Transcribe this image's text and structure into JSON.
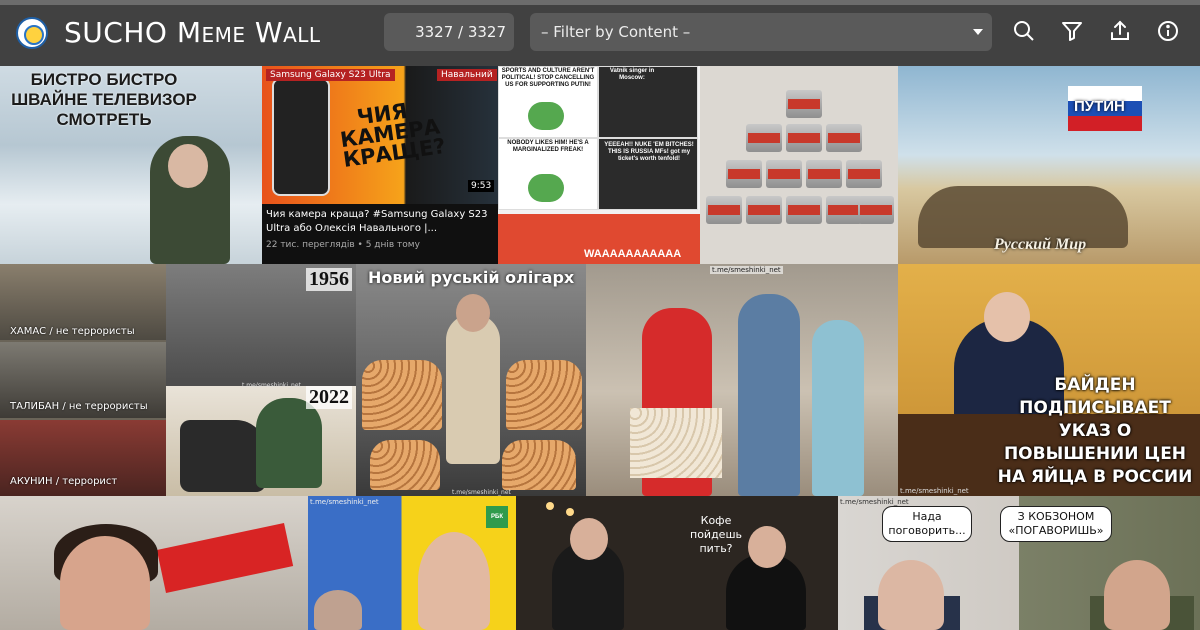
{
  "app": {
    "title_first": "SUCHO ",
    "title_rest": "Meme Wall",
    "counter": "3327 / 3327",
    "filter_placeholder": "– Filter by Content –"
  },
  "toolbar": {
    "icons": [
      "search-icon",
      "filter-icon",
      "share-icon",
      "info-icon"
    ]
  },
  "memes": {
    "m1": {
      "caption": "БИСТРО БИСТРО ШВАЙНЕ ТЕЛЕВИЗОР СМОТРЕТЬ"
    },
    "m2": {
      "badge_left": "Samsung Galaxy S23 Ultra",
      "badge_right": "Навальний",
      "headline": "ЧИЯ КАМЕРА КРАЩЕ?",
      "duration": "9:53",
      "video_title": "Чия камера краща? #Samsung Galaxy S23 Ultra або Олексія Навального |...",
      "video_meta": "22 тис. переглядів • 5 днів тому"
    },
    "m3": {
      "q1": "SPORTS AND CULTURE AREN'T POLITICAL! STOP CANCELLING US FOR SUPPORTING PUTIN!",
      "q2": "Vatnik singer in Moscow:",
      "q3": "NOBODY LIKES HIM! HE'S A MARGINALIZED FREAK!",
      "q4": "YEEEAH!! NUKE 'EM BITCHES! THIS IS RUSSIA MFs! got my ticket's worth tenfold!",
      "bottom": "WAAAAAAAAAAA"
    },
    "m4": {},
    "m5": {
      "flag_text": "ПУТИН",
      "caption": "Русский Мир"
    },
    "m6": {
      "cap1": "ХАМАС / не террористы",
      "cap2": "ТАЛИБАН / не террористы",
      "cap3": "АКУНИН / террорист"
    },
    "m7": {
      "year_top": "1956",
      "year_bottom": "2022",
      "watermark": "t.me/smeshinki_net"
    },
    "m8": {
      "caption": "Новий руській олігарх",
      "watermark": "t.me/smeshinki_net"
    },
    "m9": {
      "watermark": "t.me/smeshinki_net"
    },
    "m10": {
      "caption": "БАЙДЕН ПОДПИСЫВАЕТ УКАЗ О ПОВЫШЕНИИ ЦЕН НА ЯЙЦА В РОССИИ",
      "watermark": "t.me/smeshinki_net"
    },
    "m11": {},
    "m12": {
      "logo": "РБК",
      "watermark": "t.me/smeshinki_net"
    },
    "m13": {
      "bubble": "Кофе пойдешь пить?"
    },
    "m14": {
      "bubble1": "Нада поговорить...",
      "bubble2": "З КОБЗОНОМ «ПОГАВОРИШЬ»",
      "watermark": "t.me/smeshinki_net"
    }
  },
  "colors": {
    "topbar": "#414141",
    "control_bg": "#5a5a5a",
    "page_bg": "#1f1f1f"
  }
}
